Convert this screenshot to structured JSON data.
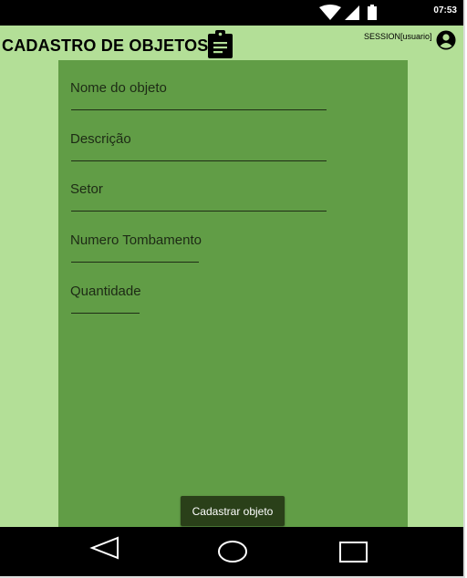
{
  "status_bar": {
    "time": "07:53",
    "icons": [
      "wifi-icon",
      "signal-icon",
      "battery-icon"
    ]
  },
  "header": {
    "title": "CADASTRO DE OBJETOS",
    "title_icon": "clipboard-icon",
    "session_text": "SESSION[usuario]",
    "account_icon": "account-circle-icon"
  },
  "form": {
    "fields": [
      {
        "label": "Nome do objeto"
      },
      {
        "label": "Descrição"
      },
      {
        "label": "Setor"
      },
      {
        "label": "Numero Tombamento"
      },
      {
        "label": "Quantidade"
      }
    ],
    "submit_label": "Cadastrar objeto"
  },
  "nav_bar": {
    "buttons": [
      "back-icon",
      "home-icon",
      "recents-icon"
    ]
  },
  "colors": {
    "background": "#b3df97",
    "panel": "#619d46",
    "button": "#2a4019",
    "system_bars": "#000000"
  }
}
